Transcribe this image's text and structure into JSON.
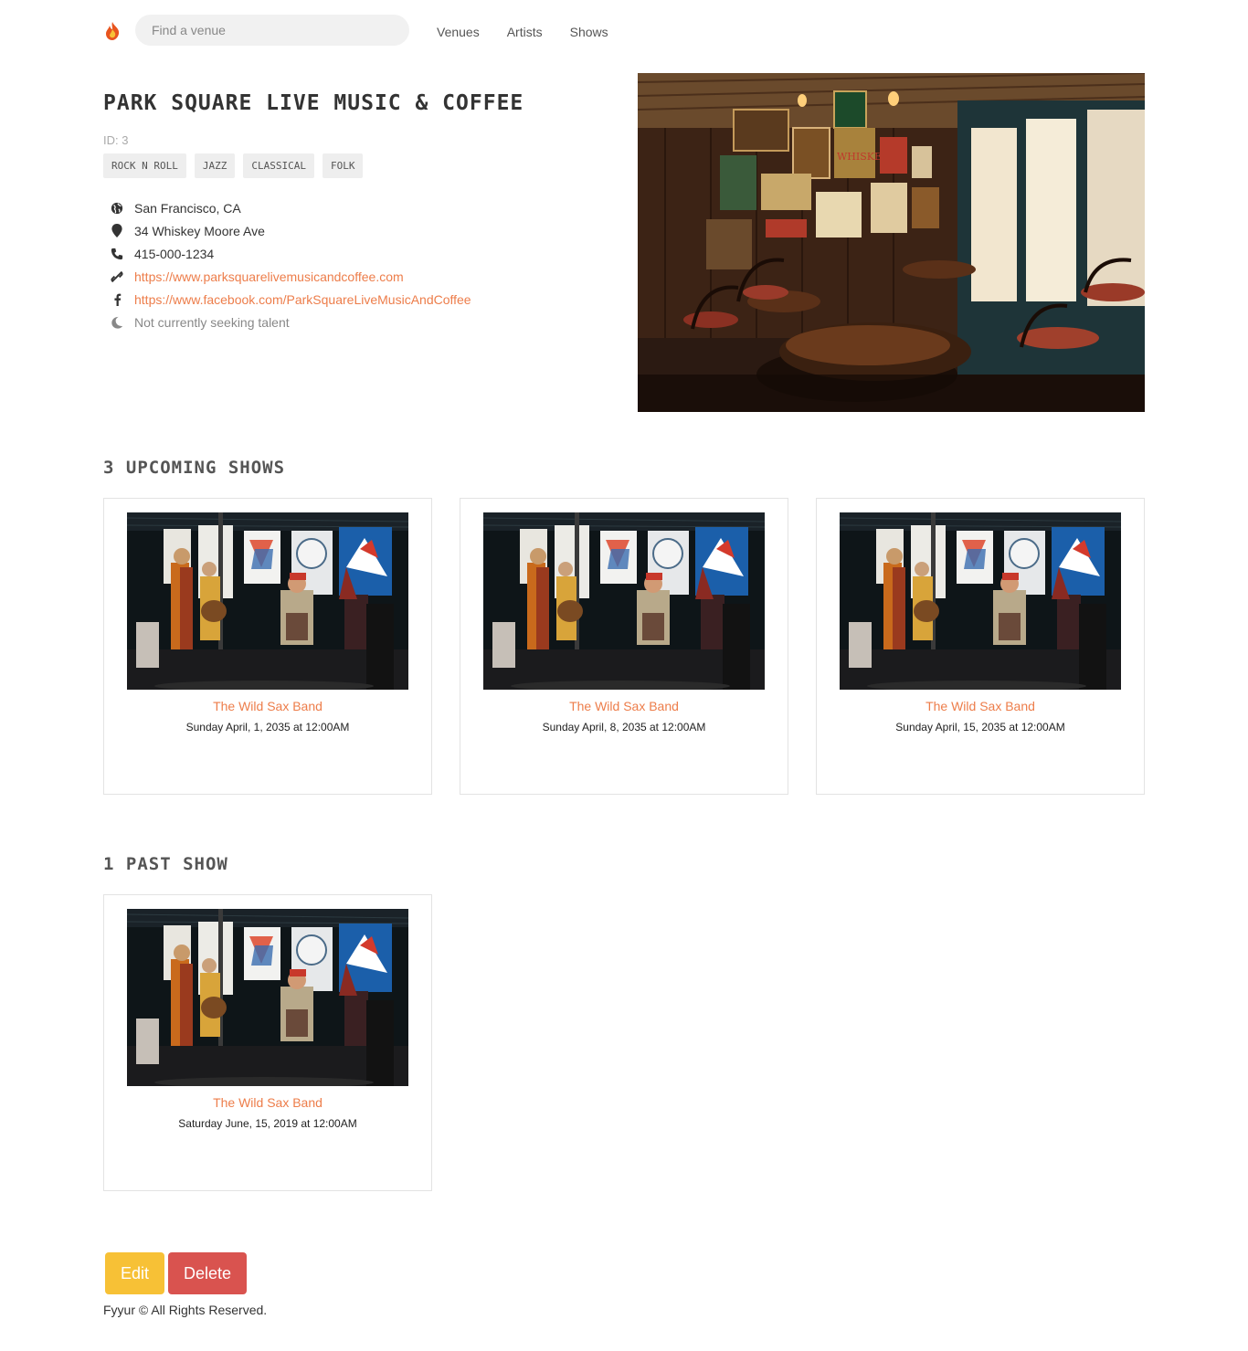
{
  "nav": {
    "search_placeholder": "Find a venue",
    "links": [
      "Venues",
      "Artists",
      "Shows"
    ]
  },
  "venue": {
    "name": "Park Square Live Music & Coffee",
    "id_text": "ID: 3",
    "genres": [
      "ROCK N ROLL",
      "JAZZ",
      "CLASSICAL",
      "FOLK"
    ],
    "city_state": "San Francisco, CA",
    "address": "34 Whiskey Moore Ave",
    "phone": "415-000-1234",
    "website": "https://www.parksquarelivemusicandcoffee.com",
    "facebook": "https://www.facebook.com/ParkSquareLiveMusicAndCoffee",
    "seeking": "Not currently seeking talent"
  },
  "upcoming": {
    "title": "3 Upcoming Shows",
    "shows": [
      {
        "artist": "The Wild Sax Band",
        "date": "Sunday April, 1, 2035 at 12:00AM"
      },
      {
        "artist": "The Wild Sax Band",
        "date": "Sunday April, 8, 2035 at 12:00AM"
      },
      {
        "artist": "The Wild Sax Band",
        "date": "Sunday April, 15, 2035 at 12:00AM"
      }
    ]
  },
  "past": {
    "title": "1 Past Show",
    "shows": [
      {
        "artist": "The Wild Sax Band",
        "date": "Saturday June, 15, 2019 at 12:00AM"
      }
    ]
  },
  "actions": {
    "edit": "Edit",
    "delete": "Delete"
  },
  "footer": "Fyyur © All Rights Reserved.",
  "colors": {
    "link": "#ed7d4a",
    "edit": "#f7c136",
    "delete": "#d9534f"
  }
}
